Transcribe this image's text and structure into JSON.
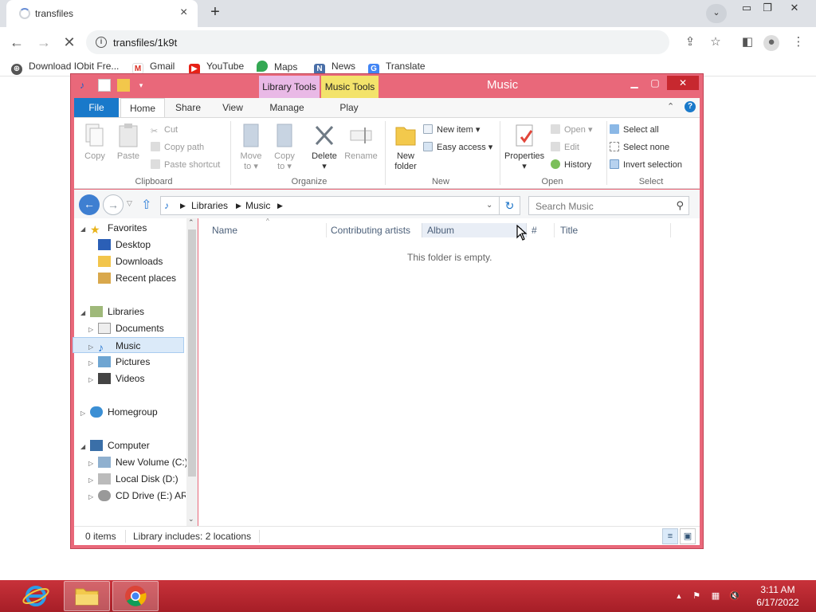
{
  "browser": {
    "tab_title": "transfiles",
    "tab_close": "×",
    "new_tab": "+",
    "url": "transfiles/1k9t",
    "bookmarks": [
      {
        "label": "Download IObit Fre...",
        "icon": "iobit-icon"
      },
      {
        "label": "Gmail",
        "icon": "gmail-icon"
      },
      {
        "label": "YouTube",
        "icon": "youtube-icon"
      },
      {
        "label": "Maps",
        "icon": "maps-icon"
      },
      {
        "label": "News",
        "icon": "news-icon"
      },
      {
        "label": "Translate",
        "icon": "translate-icon"
      }
    ]
  },
  "explorer": {
    "window_title": "Music",
    "contextual_tabs": {
      "library_tools": "Library Tools",
      "music_tools": "Music Tools"
    },
    "ribbon_tabs": [
      "File",
      "Home",
      "Share",
      "View",
      "Manage",
      "Play"
    ],
    "clipboard": {
      "copy": "Copy",
      "paste": "Paste",
      "cut": "Cut",
      "copy_path": "Copy path",
      "paste_shortcut": "Paste shortcut",
      "group": "Clipboard"
    },
    "organize": {
      "move_to": "Move",
      "move_to_2": "to ▾",
      "copy_to": "Copy",
      "copy_to_2": "to ▾",
      "delete": "Delete",
      "delete_2": "▾",
      "rename": "Rename",
      "group": "Organize"
    },
    "new": {
      "new_folder": "New",
      "new_folder_2": "folder",
      "new_item": "New item ▾",
      "easy_access": "Easy access ▾",
      "group": "New"
    },
    "open": {
      "properties": "Properties",
      "properties_2": "▾",
      "open": "Open ▾",
      "edit": "Edit",
      "history": "History",
      "group": "Open"
    },
    "select": {
      "select_all": "Select all",
      "select_none": "Select none",
      "invert": "Invert selection",
      "group": "Select"
    },
    "address": {
      "crumb_libraries": "Libraries",
      "crumb_music": "Music",
      "search_placeholder": "Search Music"
    },
    "nav": {
      "favorites": "Favorites",
      "desktop": "Desktop",
      "downloads": "Downloads",
      "recent": "Recent places",
      "libraries": "Libraries",
      "documents": "Documents",
      "music": "Music",
      "pictures": "Pictures",
      "videos": "Videos",
      "homegroup": "Homegroup",
      "computer": "Computer",
      "c_drive": "New Volume (C:)",
      "d_drive": "Local Disk (D:)",
      "e_drive": "CD Drive (E:) ARC"
    },
    "columns": {
      "name": "Name",
      "contributing_artists": "Contributing artists",
      "album": "Album",
      "number": "#",
      "title": "Title"
    },
    "empty_message": "This folder is empty.",
    "status": {
      "items": "0 items",
      "library_info": "Library includes: 2 locations"
    }
  },
  "taskbar": {
    "time": "3:11 AM",
    "date": "6/17/2022"
  },
  "colors": {
    "window_frame": "#e9687a",
    "taskbar": "#b5242d",
    "file_tab": "#1979ca"
  }
}
